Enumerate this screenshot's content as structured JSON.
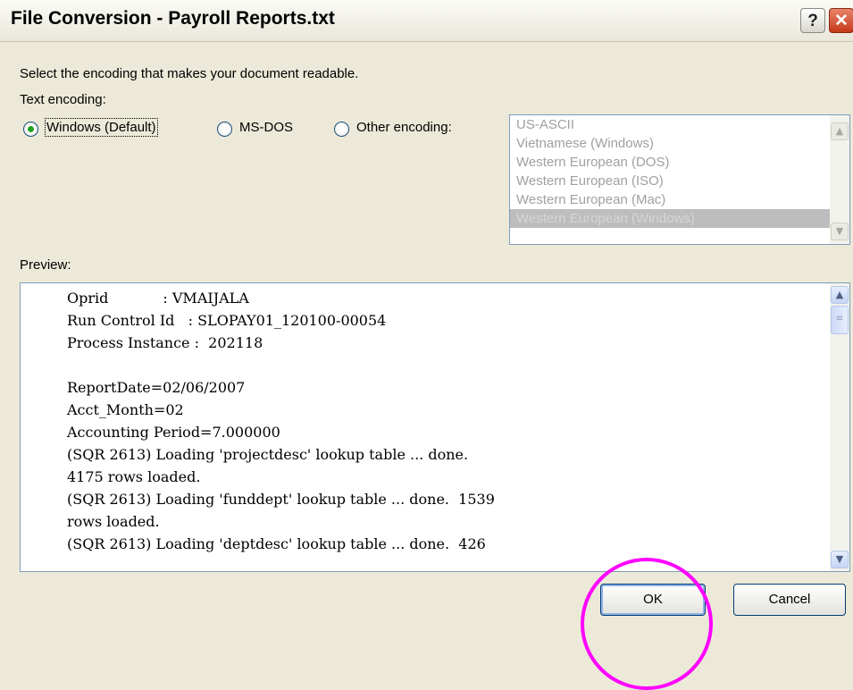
{
  "window": {
    "title": "File Conversion - Payroll Reports.txt",
    "help_icon_glyph": "?",
    "close_icon_glyph": "✕"
  },
  "instructions": "Select the encoding that makes your document readable.",
  "text_encoding_label": "Text encoding:",
  "encoding_options": [
    {
      "label": "Windows (Default)",
      "selected": true
    },
    {
      "label": "MS-DOS",
      "selected": false
    },
    {
      "label": "Other encoding:",
      "selected": false
    }
  ],
  "encoding_list": {
    "items": [
      "US-ASCII",
      "Vietnamese (Windows)",
      "Western European (DOS)",
      "Western European (ISO)",
      "Western European (Mac)",
      "Western European (Windows)"
    ],
    "selected": "Western European (Windows)",
    "disabled": true
  },
  "preview": {
    "label": "Preview:",
    "lines": [
      "Oprid            : VMAIJALA",
      "Run Control Id   : SLOPAY01_120100-00054",
      "Process Instance :  202118",
      "",
      "ReportDate=02/06/2007",
      "Acct_Month=02",
      "Accounting Period=7.000000",
      "(SQR 2613) Loading 'projectdesc' lookup table ... done.",
      "4175 rows loaded.",
      "(SQR 2613) Loading 'funddept' lookup table ... done.  1539",
      "rows loaded.",
      "(SQR 2613) Loading 'deptdesc' lookup table ... done.  426"
    ]
  },
  "buttons": {
    "ok": "OK",
    "cancel": "Cancel"
  },
  "annotation_color": "#ff00ff",
  "icons": {
    "help": "help-icon",
    "close": "close-icon",
    "scroll_up": "chevron-up-icon",
    "scroll_down": "chevron-down-icon"
  }
}
